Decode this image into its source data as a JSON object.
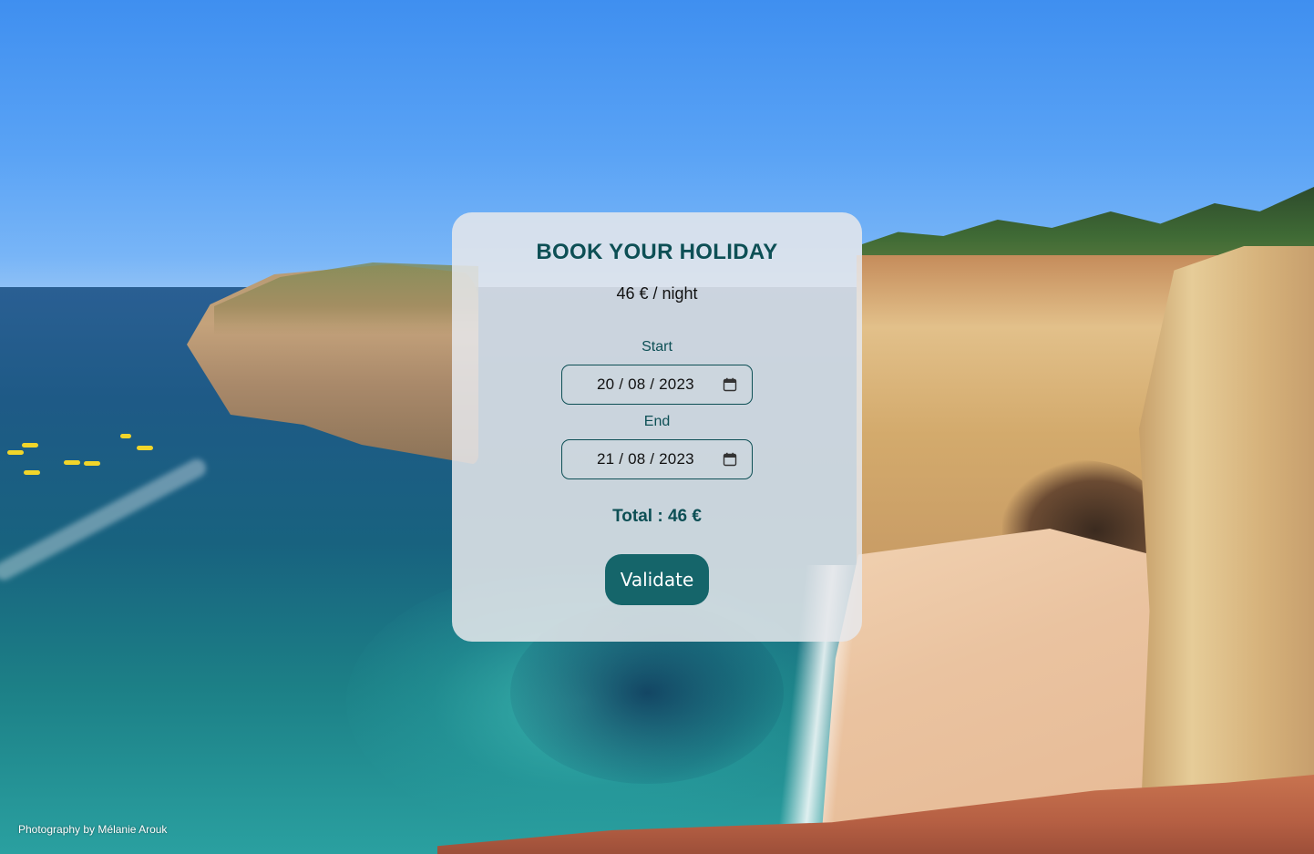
{
  "booking": {
    "title": "BOOK YOUR HOLIDAY",
    "price": "46 € / night",
    "start_label": "Start",
    "start_value": "20 / 08 / 2023",
    "end_label": "End",
    "end_value": "21 / 08 / 2023",
    "total": "Total : 46 €",
    "validate_label": "Validate"
  },
  "footer": {
    "credit": "Photography by Mélanie Arouk"
  },
  "icons": {
    "date_picker": "calendar-icon"
  },
  "colors": {
    "accent": "#0d4f55",
    "button": "#15656a",
    "card_background": "#e6e8eb"
  }
}
